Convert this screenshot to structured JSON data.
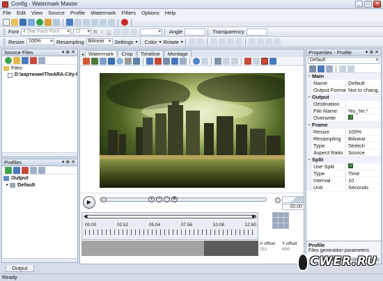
{
  "window": {
    "title": "Config - Watermark Master",
    "minimize": "_",
    "maximize": "□",
    "close": "✕"
  },
  "menu": [
    "File",
    "Edit",
    "View",
    "Source",
    "Profile",
    "Watermark",
    "Filters",
    "Options",
    "Help"
  ],
  "toolbar_text": {
    "font_label": "Font",
    "font_value": "4 Star Face Font",
    "size_value": "12",
    "bold": "B",
    "italic": "I",
    "underline": "U",
    "angle_label": "Angle",
    "transparency_label": "Transparency"
  },
  "toolbar_resize": {
    "resize_label": "Resize",
    "resize_value": "100%",
    "resampling_label": "Resampling",
    "resampling_value": "Bilinear",
    "settings_label": "Settings",
    "color_label": "Color",
    "rotate_label": "Rotate"
  },
  "source_files": {
    "title": "Source Files",
    "root": "Files",
    "item": "D:\\картинки\\TheARA-City-l"
  },
  "profiles": {
    "title": "Profiles",
    "root": "Output",
    "item": "Default"
  },
  "center": {
    "tabs": [
      "Watermark",
      "Crop",
      "Timeline",
      "Montage"
    ],
    "active_tab": "Watermark",
    "time_readout": "00:00",
    "ruler_ticks": [
      "00.00",
      "02.52",
      "05.04",
      "07.56",
      "10.08",
      "12.60"
    ],
    "x_offset_label": "X offset",
    "x_offset_value": "251",
    "y_offset_label": "Y offset",
    "y_offset_value": "698"
  },
  "properties": {
    "title": "Properties - Profile",
    "profile_select": "Default",
    "sections": [
      {
        "name": "Main",
        "rows": [
          {
            "k": "Name",
            "v": "Default"
          },
          {
            "k": "Output Forma",
            "v": "Not to chang..."
          }
        ]
      },
      {
        "name": "Output",
        "rows": [
          {
            "k": "Destination",
            "v": ""
          },
          {
            "k": "File Name",
            "v": "%s_%r.*"
          },
          {
            "k": "Overwrite",
            "v": "",
            "check": true
          }
        ]
      },
      {
        "name": "Frame",
        "rows": [
          {
            "k": "Resize",
            "v": "100%"
          },
          {
            "k": "Resampling",
            "v": "Bilinear"
          },
          {
            "k": "Type",
            "v": "Stretch"
          },
          {
            "k": "Aspect Ratio",
            "v": "Source"
          }
        ]
      },
      {
        "name": "Split",
        "rows": [
          {
            "k": "Use Split",
            "v": "",
            "check": true
          },
          {
            "k": "Type",
            "v": "Time"
          },
          {
            "k": "Interval",
            "v": "10"
          },
          {
            "k": "Unit",
            "v": "Seconds"
          }
        ]
      }
    ],
    "help_title": "Profile",
    "help_text": "Files generation parameters",
    "hint": "Hint (double click to show)"
  },
  "bottom_tab": "Output",
  "status": "Ready",
  "watermark_logo": "CWER.RU",
  "colors": {
    "accent": "#c0392b",
    "panel_border": "#9fb0c6",
    "timeline_dark": "#5c5c5c"
  }
}
